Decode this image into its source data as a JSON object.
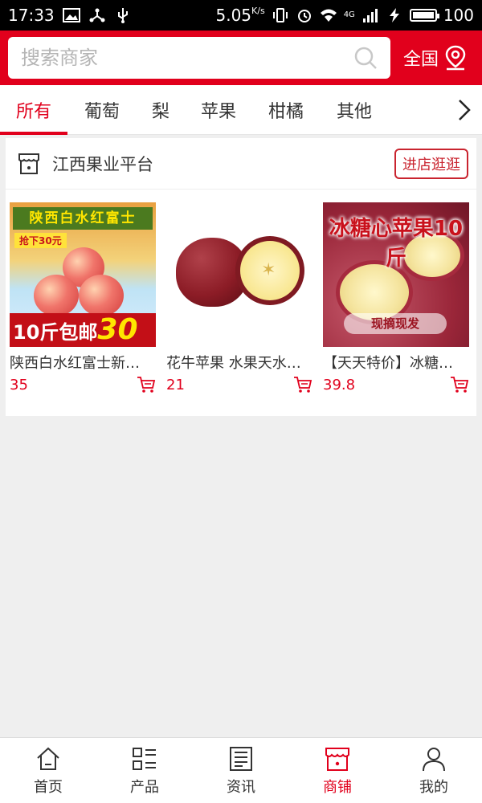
{
  "status_bar": {
    "time": "17:33",
    "speed": "5.05",
    "speed_unit": "K/s",
    "network": "4G",
    "battery": "100"
  },
  "search": {
    "placeholder": "搜索商家",
    "region_label": "全国"
  },
  "tabs": [
    {
      "label": "所有",
      "active": true
    },
    {
      "label": "葡萄",
      "active": false
    },
    {
      "label": "梨",
      "active": false
    },
    {
      "label": "苹果",
      "active": false
    },
    {
      "label": "柑橘",
      "active": false
    },
    {
      "label": "其他",
      "active": false
    }
  ],
  "store": {
    "name": "江西果业平台",
    "enter_label": "进店逛逛",
    "products": [
      {
        "title": "陕西白水红富士新…",
        "price": "35",
        "image_text": {
          "banner": "陕西白水红富士",
          "tag": "抢下30元",
          "bottom_prefix": "10斤包邮",
          "bottom_big": "30"
        }
      },
      {
        "title": "花牛苹果 水果天水…",
        "price": "21"
      },
      {
        "title": "【天天特价】冰糖…",
        "price": "39.8",
        "image_text": {
          "title": "冰糖心苹果10斤",
          "pill": "现摘现发"
        }
      }
    ]
  },
  "bottom_nav": [
    {
      "label": "首页",
      "icon": "home-icon",
      "active": false
    },
    {
      "label": "产品",
      "icon": "product-grid-icon",
      "active": false
    },
    {
      "label": "资讯",
      "icon": "news-icon",
      "active": false
    },
    {
      "label": "商铺",
      "icon": "shop-icon",
      "active": true
    },
    {
      "label": "我的",
      "icon": "user-icon",
      "active": false
    }
  ],
  "colors": {
    "brand_red": "#e1001c",
    "price_red": "#e1001c"
  }
}
